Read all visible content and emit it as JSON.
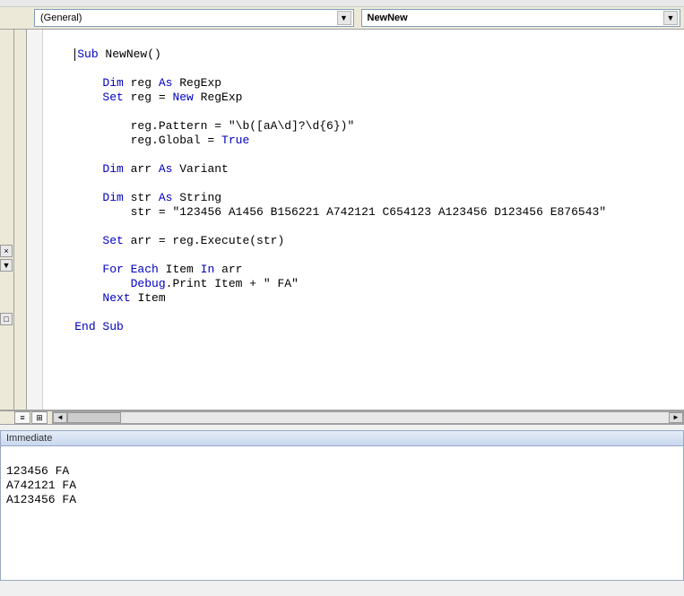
{
  "dropdowns": {
    "object": "(General)",
    "procedure": "NewNew"
  },
  "toolbar_hint": "",
  "code": {
    "l1": "    Sub NewNew()",
    "l2": "",
    "l3": "        Dim reg As RegExp",
    "l4": "        Set reg = New RegExp",
    "l5": "",
    "l6": "            reg.Pattern = \"\\b([aA\\d]?\\d{6})\"",
    "l7": "            reg.Global = True",
    "l8": "",
    "l9": "        Dim arr As Variant",
    "l10": "",
    "l11": "        Dim str As String",
    "l12": "            str = \"123456 A1456 B156221 A742121 C654123 A123456 D123456 E876543\"",
    "l13": "",
    "l14": "        Set arr = reg.Execute(str)",
    "l15": "",
    "l16": "        For Each Item In arr",
    "l17": "            Debug.Print Item + \" FA\"",
    "l18": "        Next Item",
    "l19": "",
    "l20": "    End Sub"
  },
  "immediate": {
    "title": "Immediate",
    "lines": [
      "123456 FA",
      "A742121 FA",
      "A123456 FA"
    ]
  },
  "glyph": {
    "down": "▼",
    "left": "◄",
    "right": "►",
    "close": "×",
    "proc_view": "≡",
    "full_view": "⊞"
  }
}
